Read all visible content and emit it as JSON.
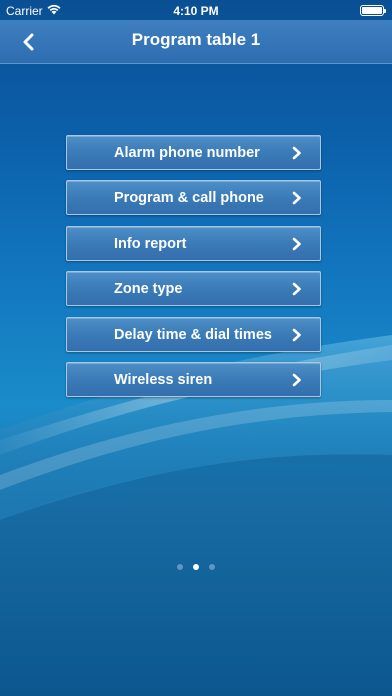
{
  "status_bar": {
    "carrier": "Carrier",
    "time": "4:10 PM"
  },
  "nav": {
    "title": "Program table 1",
    "back_icon": "chevron-left-icon"
  },
  "menu": [
    {
      "label": "Alarm phone number"
    },
    {
      "label": "Program & call phone"
    },
    {
      "label": "Info report"
    },
    {
      "label": "Zone type"
    },
    {
      "label": "Delay time & dial times"
    },
    {
      "label": "Wireless siren"
    }
  ],
  "pager": {
    "page_count": 3,
    "current_page": 2
  },
  "colors": {
    "nav_bar": "#3575b7",
    "button": "#3f80bc",
    "button_border": "#a7c8e4",
    "text": "#ffffff"
  }
}
